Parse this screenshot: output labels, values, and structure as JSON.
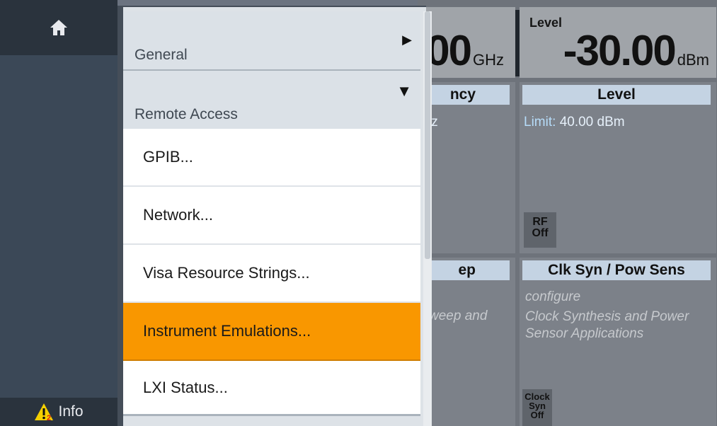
{
  "sidebar": {
    "home_icon": "home-icon",
    "info_label": "Info",
    "info_icon": "warning-icon",
    "info_badge": "2"
  },
  "menu": {
    "general_label": "General",
    "remote_access_label": "Remote Access",
    "items": [
      {
        "label": "GPIB..."
      },
      {
        "label": "Network..."
      },
      {
        "label": "Visa Resource Strings..."
      },
      {
        "label": "Instrument Emulations...",
        "selected": true
      },
      {
        "label": "LXI Status..."
      }
    ]
  },
  "panels": {
    "frequency_value": "00",
    "frequency_unit": "GHz",
    "level_label": "Level",
    "level_value": "-30.00",
    "level_unit": "dBm",
    "freq_header": "ncy",
    "freq_fragment": "Iz",
    "level_header": "Level",
    "limit_key": "Limit:",
    "limit_value": "40.00 dBm",
    "rf_off_line1": "RF",
    "rf_off_line2": "Off",
    "sweep_header": "ep",
    "sweep_fragment": "weep and",
    "clk_header": "Clk Syn / Pow Sens",
    "clk_sub1": "configure",
    "clk_sub2": "Clock Synthesis and Power Sensor Applications",
    "clk_btn_line1": "Clock",
    "clk_btn_line2": "Syn",
    "clk_btn_line3": "Off"
  },
  "colors": {
    "selected_item": "#f99700",
    "sidebar": "#3b4857",
    "header_bar": "#c4d3e3"
  }
}
